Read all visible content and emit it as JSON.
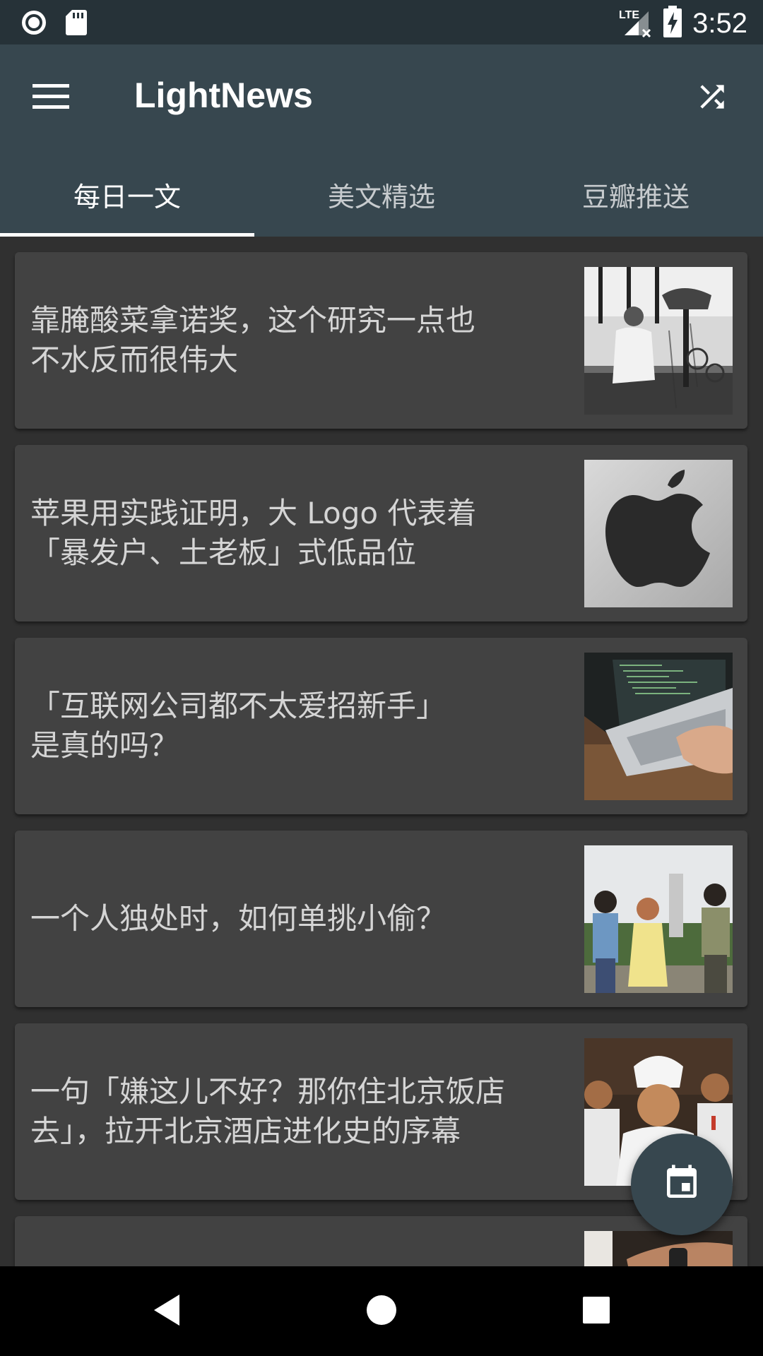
{
  "status_bar": {
    "time": "3:52",
    "network": "LTE",
    "icons": [
      "record-icon",
      "sd-card-icon",
      "signal-icon",
      "battery-charging-icon"
    ]
  },
  "app_bar": {
    "title": "LightNews",
    "menu_icon": "menu-icon",
    "action_icon": "shuffle-icon",
    "tabs": [
      {
        "label": "每日一文",
        "selected": true
      },
      {
        "label": "美文精选",
        "selected": false
      },
      {
        "label": "豆瓣推送",
        "selected": false
      }
    ]
  },
  "articles": [
    {
      "title": "靠腌酸菜拿诺奖，这个研究一点也\n不水反而很伟大",
      "image": "scientist-laboratory-photo"
    },
    {
      "title": "苹果用实践证明，大 Logo 代表着\n「暴发户、土老板」式低品位",
      "image": "apple-logo-photo"
    },
    {
      "title": "「互联网公司都不太爱招新手」\n是真的吗？",
      "image": "laptop-code-photo"
    },
    {
      "title": "一个人独处时，如何单挑小偷？",
      "image": "people-outdoor-photo"
    },
    {
      "title": "一句「嫌这儿不好？那你住北京饭店\n去」，拉开北京酒店进化史的序幕",
      "image": "chefs-group-photo"
    },
    {
      "title": "",
      "image": "hand-watch-photo"
    }
  ],
  "fab": {
    "icon": "calendar-icon"
  },
  "nav_bar": {
    "icons": [
      "back-icon",
      "home-icon",
      "recents-icon"
    ]
  },
  "colors": {
    "status_bar": "#263238",
    "app_bar": "#37474f",
    "background": "#303030",
    "card": "#424242",
    "text": "#d5d5d5"
  }
}
